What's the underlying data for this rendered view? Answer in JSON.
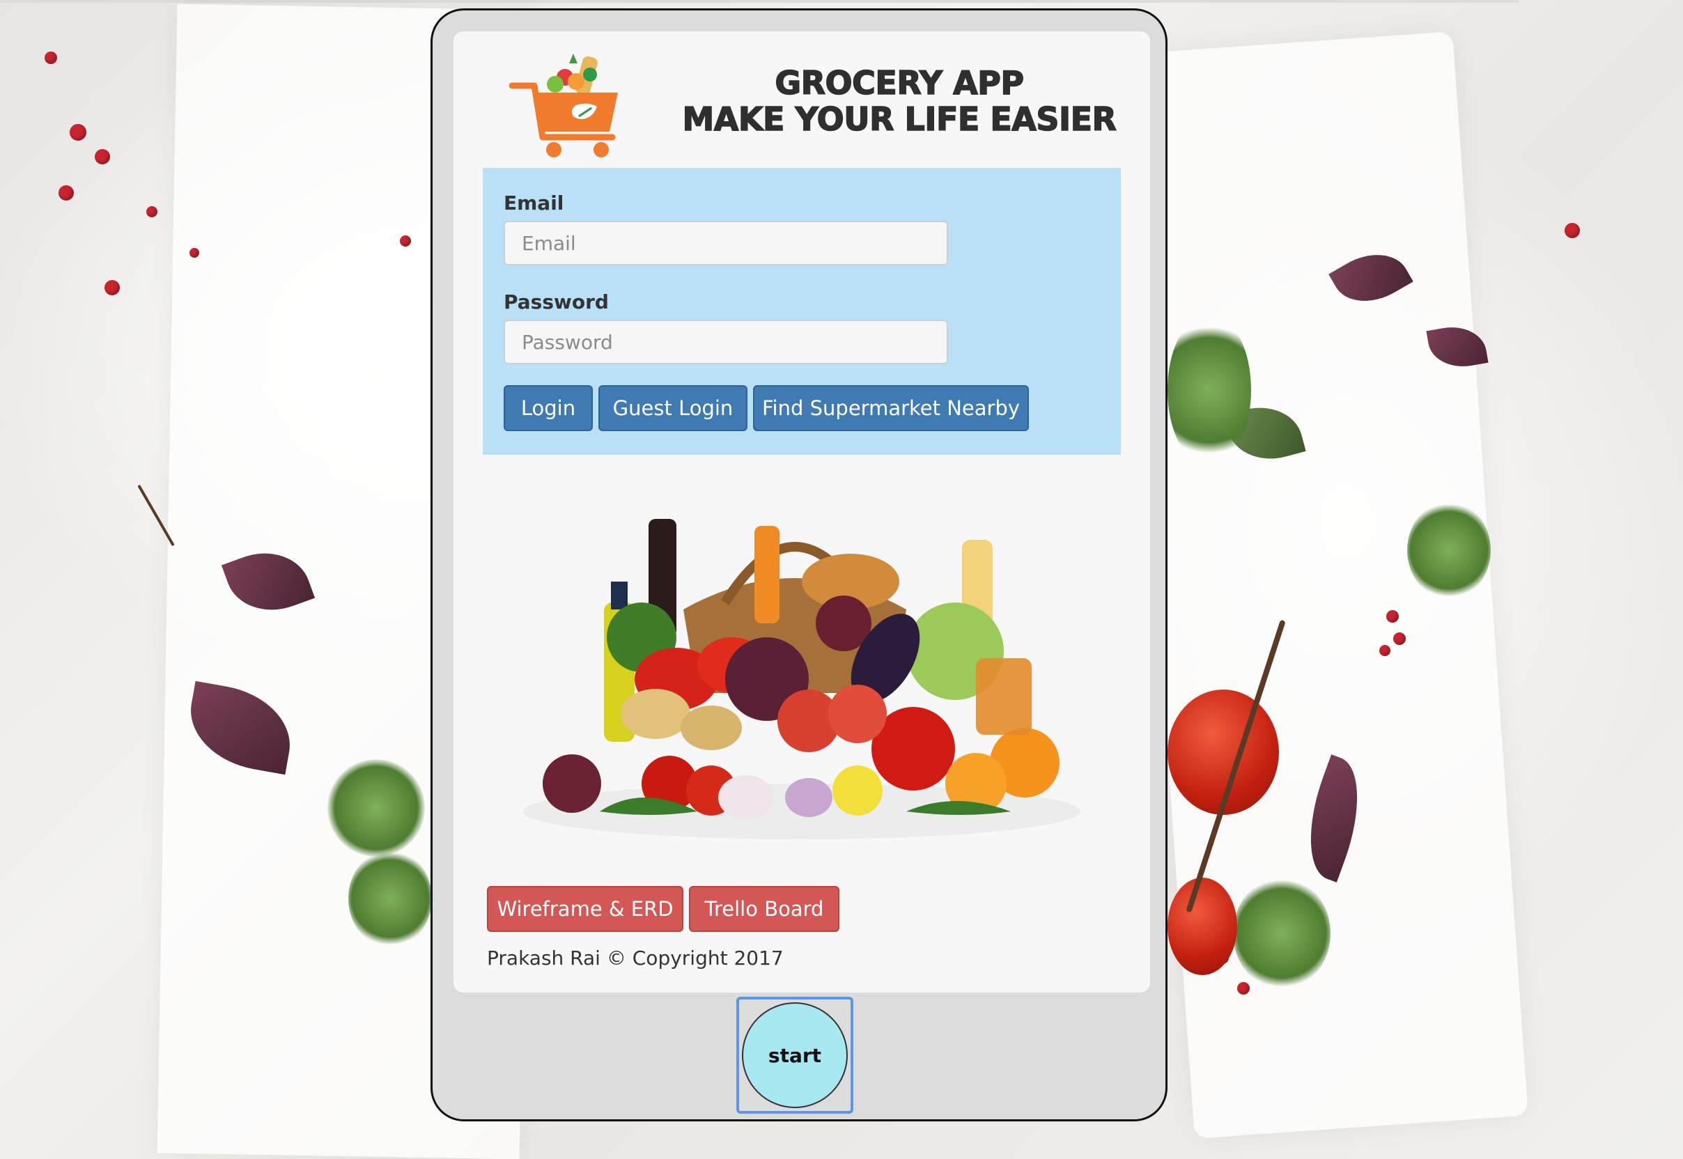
{
  "header": {
    "title_line1": "GROCERY APP",
    "title_line2": "MAKE YOUR LIFE EASIER",
    "logo_icon": "shopping-cart-icon"
  },
  "login_form": {
    "email_label": "Email",
    "email_placeholder": "Email",
    "email_value": "",
    "password_label": "Password",
    "password_placeholder": "Password",
    "password_value": "",
    "login_button": "Login",
    "guest_login_button": "Guest Login",
    "find_supermarket_button": "Find Supermarket Nearby"
  },
  "footer": {
    "wireframe_button": "Wireframe & ERD",
    "trello_button": "Trello Board",
    "copyright": "Prakash Rai © Copyright 2017"
  },
  "device": {
    "start_button": "start"
  },
  "colors": {
    "panel": "#b9e0f6",
    "primary_button": "#3f7ab3",
    "danger_button": "#d35855",
    "start_button": "#a8e8f1",
    "tablet_frame": "#dcdcdc"
  }
}
